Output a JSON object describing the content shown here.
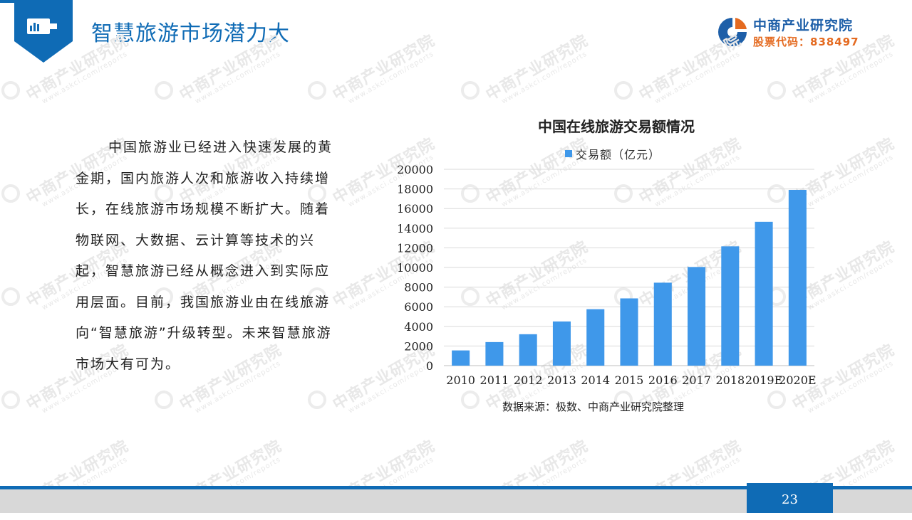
{
  "header": {
    "title": "智慧旅游市场潜力大"
  },
  "logo": {
    "name": "中商产业研究院",
    "code": "股票代码：838497",
    "colors": {
      "blue": "#1e5fa8",
      "orange": "#e46a20"
    }
  },
  "watermark": {
    "text": "中商产业研究院",
    "url": "www.askci.com/reports"
  },
  "body": {
    "paragraph": "中国旅游业已经进入快速发展的黄金期，国内旅游人次和旅游收入持续增长，在线旅游市场规模不断扩大。随着物联网、大数据、云计算等技术的兴起，智慧旅游已经从概念进入到实际应用层面。目前，我国旅游业由在线旅游向“智慧旅游”升级转型。未来智慧旅游市场大有可为。"
  },
  "chart_data": {
    "type": "bar",
    "title": "中国在线旅游交易额情况",
    "categories": [
      "2010",
      "2011",
      "2012",
      "2013",
      "2014",
      "2015",
      "2016",
      "2017",
      "2018",
      "2019E",
      "2020E"
    ],
    "series": [
      {
        "name": "交易额（亿元）",
        "values": [
          1550,
          2400,
          3200,
          4500,
          5750,
          6850,
          8450,
          10050,
          12150,
          14650,
          17900
        ],
        "color": "#3f98ea"
      }
    ],
    "ylim": [
      0,
      20000
    ],
    "yticks": [
      0,
      2000,
      4000,
      6000,
      8000,
      10000,
      12000,
      14000,
      16000,
      18000,
      20000
    ],
    "grid": true,
    "legend": "top"
  },
  "source": "数据来源：极数、中商产业研究院整理",
  "footer": {
    "page": "23",
    "accent": "#0f6bb5"
  }
}
